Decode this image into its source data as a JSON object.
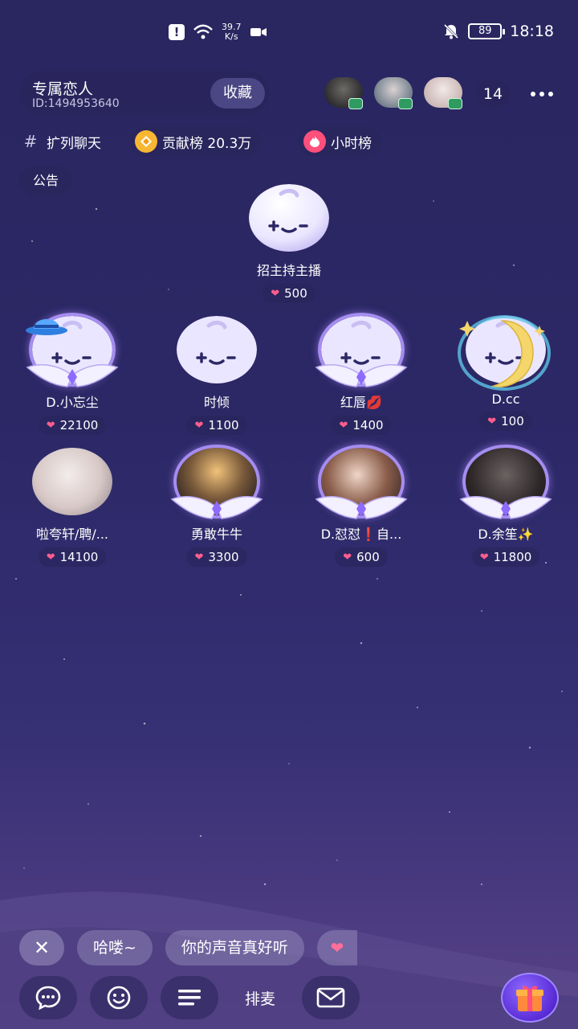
{
  "status_bar": {
    "net_speed_value": "39.7",
    "net_speed_unit": "K/s",
    "battery": "89",
    "time": "18:18",
    "icons": [
      "alert-icon",
      "wifi-icon",
      "video-icon",
      "mute-bell-icon",
      "battery-icon"
    ]
  },
  "room": {
    "name": "专属恋人",
    "id_label": "ID:1494953640",
    "favorite_label": "收藏",
    "online_count": "14"
  },
  "chips": {
    "tag_label": "扩列聊天",
    "contribution_label": "贡献榜 20.3万",
    "hourly_label": "小时榜"
  },
  "notice_label": "公告",
  "host_seat": {
    "name": "招主持主播",
    "score": "500"
  },
  "seats": [
    {
      "name": "D.小忘尘",
      "score": "22100"
    },
    {
      "name": "时倾",
      "score": "1100"
    },
    {
      "name": "红唇💋",
      "score": "1400"
    },
    {
      "name": "D.cc",
      "score": "100"
    },
    {
      "name": "啦夸轩/聘/...",
      "score": "14100"
    },
    {
      "name": "勇敢牛牛",
      "score": "3300"
    },
    {
      "name": "D.怼怼❗自...",
      "score": "600"
    },
    {
      "name": "D.余笙✨",
      "score": "11800"
    }
  ],
  "quick_replies": [
    "哈喽~",
    "你的声音真好听"
  ],
  "toolbar": {
    "queue_label": "排麦"
  },
  "colors": {
    "accent_purple": "#a58df0",
    "heart_pink": "#ff5e8e",
    "background": "#2c2866"
  }
}
